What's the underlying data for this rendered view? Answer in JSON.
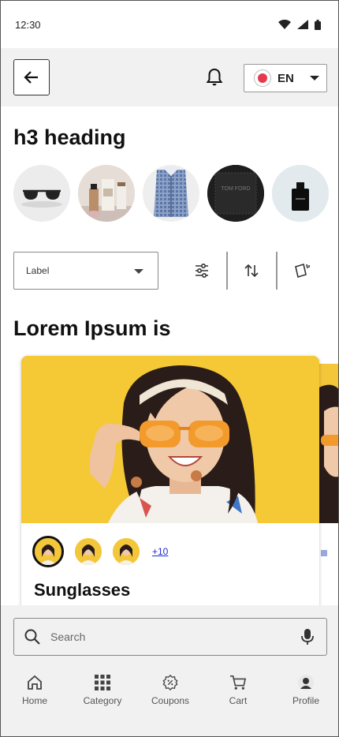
{
  "status_bar": {
    "time": "12:30"
  },
  "header": {
    "language": "EN",
    "language_flag_color": "#e53950"
  },
  "headings": {
    "section_title": "h3 heading",
    "feed_title": "Lorem Ipsum is"
  },
  "categories": [
    {
      "name": "sunglasses-thumb"
    },
    {
      "name": "cosmetics-thumb"
    },
    {
      "name": "shirt-thumb"
    },
    {
      "name": "tom-ford-thumb"
    },
    {
      "name": "perfume-thumb"
    }
  ],
  "filter": {
    "select_label": "Label",
    "tools": [
      "filter-icon",
      "sort-icon",
      "compare-icon"
    ]
  },
  "product": {
    "title": "Sunglasses",
    "more_count": "+10",
    "accent": "#f4c73a"
  },
  "search": {
    "placeholder": "Search"
  },
  "nav": {
    "items": [
      {
        "label": "Home",
        "icon": "home-icon"
      },
      {
        "label": "Category",
        "icon": "grid-icon"
      },
      {
        "label": "Coupons",
        "icon": "coupon-icon"
      },
      {
        "label": "Cart",
        "icon": "cart-icon"
      },
      {
        "label": "Profile",
        "icon": "avatar"
      }
    ]
  }
}
